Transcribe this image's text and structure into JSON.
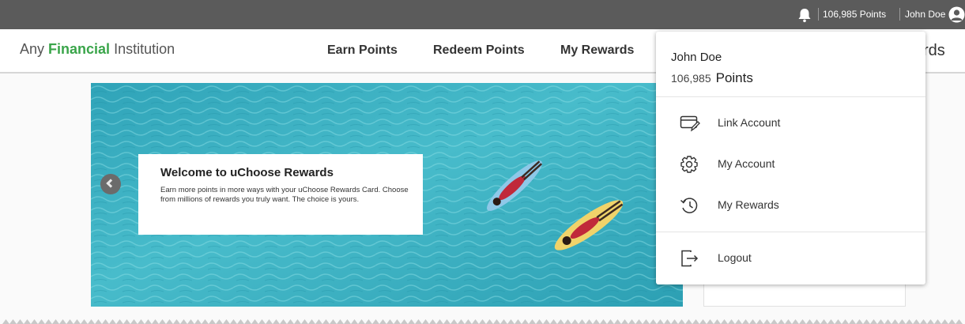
{
  "topbar": {
    "bell_icon": "bell-icon",
    "points_text": "106,985 Points",
    "user_name": "John Doe",
    "user_icon": "user-circle-icon"
  },
  "header": {
    "logo": {
      "part1": "Any ",
      "part2": "Financial",
      "part3": " Institution"
    },
    "nav": {
      "earn": "Earn Points",
      "redeem": "Redeem Points",
      "rewards": "My Rewards",
      "partial": "rds"
    }
  },
  "hero": {
    "title": "Welcome to uChoose Rewards",
    "description": "Earn more points in more ways with your uChoose Rewards Card. Choose from millions of rewards you truly want. The choice is yours.",
    "prev_icon": "chevron-left-icon"
  },
  "dropdown": {
    "name": "John Doe",
    "points_value": "106,985",
    "points_label": "Points",
    "items": [
      {
        "label": "Link Account",
        "icon": "card-link-icon"
      },
      {
        "label": "My Account",
        "icon": "gear-icon"
      },
      {
        "label": "My Rewards",
        "icon": "history-icon"
      },
      {
        "label": "Logout",
        "icon": "logout-icon"
      }
    ]
  },
  "colors": {
    "topbar": "#5b5b5b",
    "brand_green": "#3aa54a",
    "water": "#3fb3c4"
  }
}
